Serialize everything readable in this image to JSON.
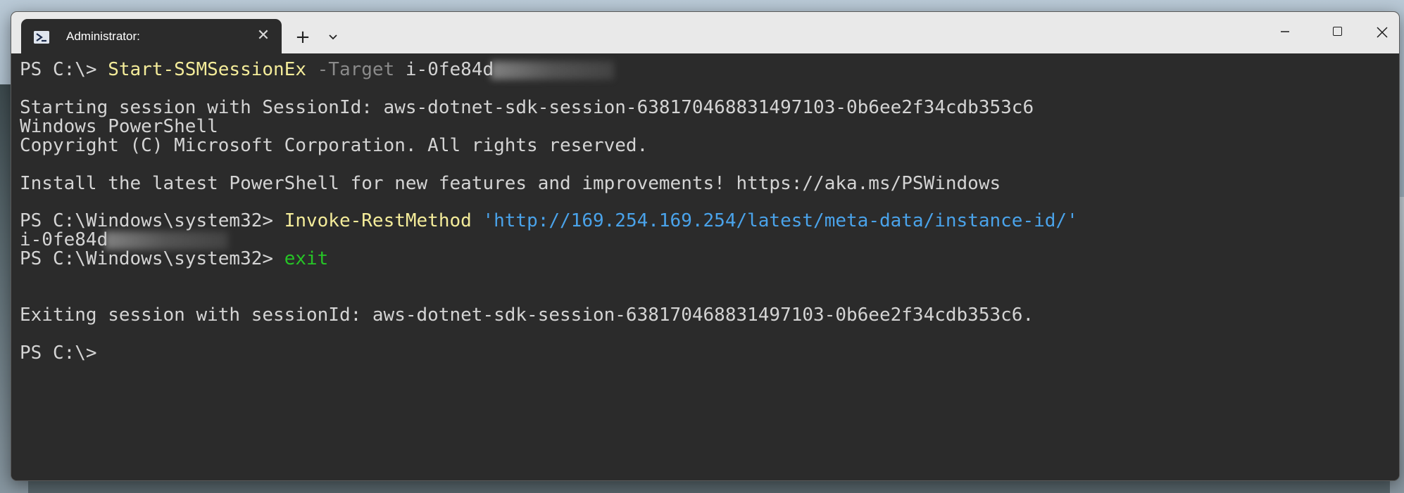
{
  "window": {
    "tab_title": "Administrator:",
    "tab_close_glyph": "✕",
    "new_tab_glyph": "+",
    "dropdown_glyph": "⌄",
    "minimize_glyph": "—",
    "close_glyph": "✕",
    "tab_icon": "powershell-icon"
  },
  "terminal": {
    "l1": {
      "prompt": "PS C:\\> ",
      "cmd": "Start-SSMSessionEx",
      "param": " -Target",
      "arg": " i-0fe84d"
    },
    "l2": "Starting session with SessionId: aws-dotnet-sdk-session-638170468831497103-0b6ee2f34cdb353c6",
    "l3": "Windows PowerShell",
    "l4": "Copyright (C) Microsoft Corporation. All rights reserved.",
    "l5": "Install the latest PowerShell for new features and improvements! https://aka.ms/PSWindows",
    "l6": {
      "prompt": "PS C:\\Windows\\system32> ",
      "cmd": "Invoke-RestMethod",
      "str": " 'http://169.254.169.254/latest/meta-data/instance-id/'"
    },
    "l7": "i-0fe84d",
    "l8": {
      "prompt": "PS C:\\Windows\\system32> ",
      "cmd": "exit"
    },
    "l9": "Exiting session with sessionId: aws-dotnet-sdk-session-638170468831497103-0b6ee2f34cdb353c6.",
    "l10": "PS C:\\> "
  },
  "colors": {
    "command": "#f4ec9a",
    "parameter": "#8a8a8a",
    "string": "#4aa3ea",
    "exit": "#26c426",
    "background": "#2b2b2b"
  }
}
